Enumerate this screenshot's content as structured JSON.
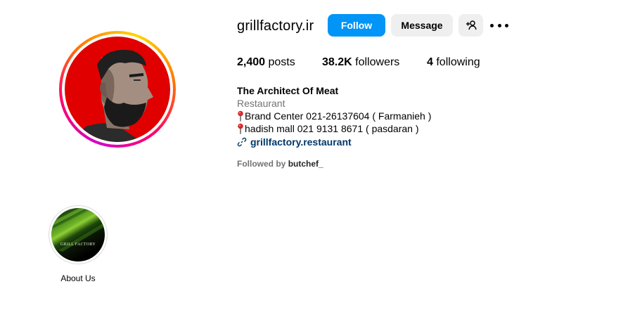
{
  "profile": {
    "username": "grillfactory.ir",
    "avatar_icon": "bearded-man-avatar",
    "follow_label": "Follow",
    "message_label": "Message",
    "add_user_icon": "add-user-icon",
    "more_icon": "more-options-icon"
  },
  "stats": {
    "posts_count": "2,400",
    "posts_label": "posts",
    "followers_count": "38.2K",
    "followers_label": "followers",
    "following_count": "4",
    "following_label": "following"
  },
  "bio": {
    "name": "The Architect Of Meat",
    "category": "Restaurant",
    "line1": "Brand Center 021-26137604 ( Farmanieh )",
    "line2": "hadish mall 021 9131 8671 ( pasdaran )",
    "pin_icon": "round-pushpin-icon",
    "link": "grillfactory.restaurant",
    "link_icon": "link-icon"
  },
  "followed_by": {
    "prefix": "Followed by",
    "user": "butchef_"
  },
  "highlights": [
    {
      "label": "About Us",
      "cover_text": "GRILL FACTORY"
    }
  ],
  "colors": {
    "follow_button": "#0095f6",
    "secondary_button": "#efefef",
    "link": "#00376b",
    "muted": "#737373",
    "avatar_background": "#e00000"
  }
}
